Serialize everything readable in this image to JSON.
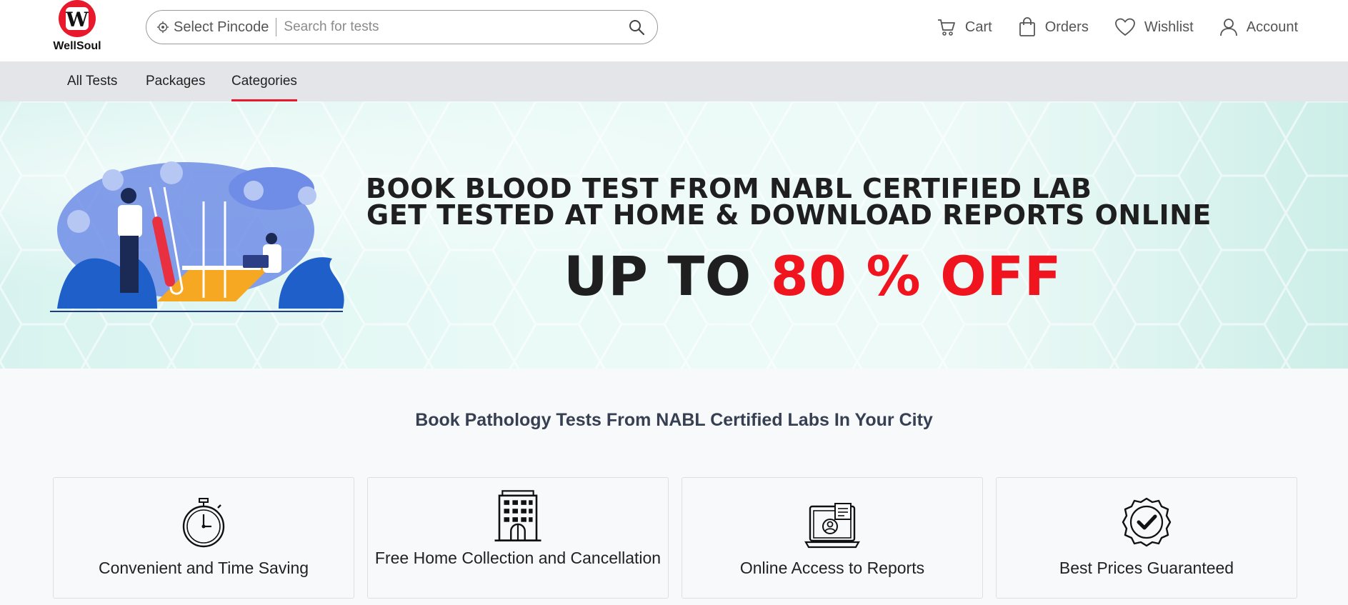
{
  "brand": {
    "name": "WellSoul",
    "logo_letter": "W"
  },
  "search": {
    "pincode_label": "Select Pincode",
    "placeholder": "Search for tests"
  },
  "header_actions": [
    {
      "label": "Cart",
      "icon": "cart-icon"
    },
    {
      "label": "Orders",
      "icon": "bag-icon"
    },
    {
      "label": "Wishlist",
      "icon": "heart-icon"
    },
    {
      "label": "Account",
      "icon": "user-icon"
    }
  ],
  "tabs": [
    {
      "label": "All Tests",
      "active": false
    },
    {
      "label": "Packages",
      "active": false
    },
    {
      "label": "Categories",
      "active": true
    }
  ],
  "banner": {
    "line1": "BOOK BLOOD TEST FROM NABL CERTIFIED LAB",
    "line2": "GET TESTED AT HOME & DOWNLOAD REPORTS ONLINE",
    "line3_prefix": "UP TO ",
    "line3_highlight": "80 % OFF"
  },
  "section": {
    "title": "Book Pathology Tests From NABL Certified Labs In Your City",
    "features": [
      {
        "label": "Convenient and Time Saving",
        "icon": "stopwatch-icon"
      },
      {
        "label": "Free Home Collection and Cancellation",
        "icon": "building-icon"
      },
      {
        "label": "Online Access to Reports",
        "icon": "laptop-report-icon"
      },
      {
        "label": "Best Prices Guaranteed",
        "icon": "badge-check-icon"
      }
    ]
  },
  "colors": {
    "brand_red": "#e8192c",
    "banner_red": "#f0141e",
    "subnav_bg": "#e4e5e9"
  }
}
